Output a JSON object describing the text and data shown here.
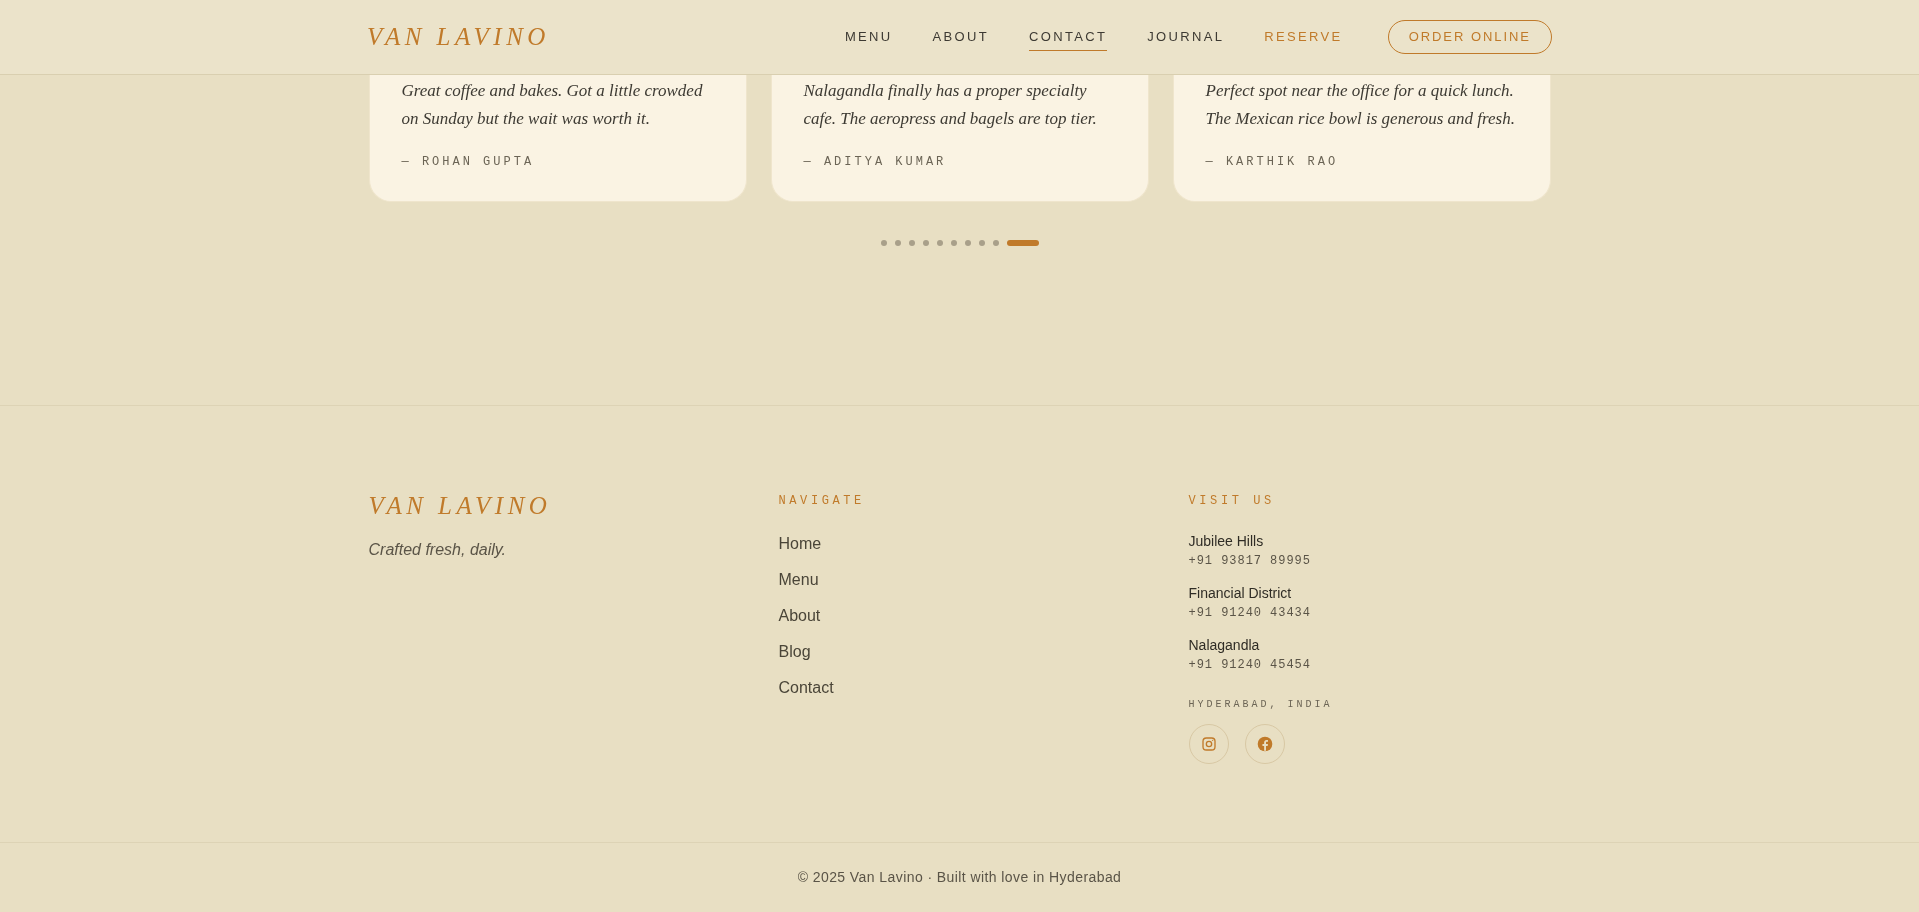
{
  "header": {
    "logo": "VAN LAVINO",
    "nav": [
      {
        "label": "MENU",
        "kind": "link",
        "selected": false
      },
      {
        "label": "ABOUT",
        "kind": "link",
        "selected": false
      },
      {
        "label": "CONTACT",
        "kind": "link",
        "selected": true
      },
      {
        "label": "JOURNAL",
        "kind": "link",
        "selected": false
      },
      {
        "label": "RESERVE",
        "kind": "accent",
        "selected": false
      }
    ],
    "cta": "ORDER ONLINE"
  },
  "testimonials": {
    "cards": [
      {
        "lines": [
          "Great coffee and bakes. Got a little crowded",
          "on Sunday but the wait was worth it."
        ],
        "author": "— ROHAN GUPTA"
      },
      {
        "lines": [
          "Nalagandla finally has a proper specialty",
          "cafe. The aeropress and bagels are top tier."
        ],
        "author": "— ADITYA KUMAR"
      },
      {
        "lines": [
          "Perfect spot near the office for a quick lunch.",
          "The Mexican rice bowl is generous and fresh."
        ],
        "author": "— KARTHIK RAO"
      }
    ],
    "dots": [
      {
        "selected": false
      },
      {
        "selected": false
      },
      {
        "selected": false
      },
      {
        "selected": false
      },
      {
        "selected": false
      },
      {
        "selected": false
      },
      {
        "selected": false
      },
      {
        "selected": false
      },
      {
        "selected": false
      },
      {
        "selected": true
      }
    ]
  },
  "footer": {
    "logo": "VAN LAVINO",
    "tagline": "Crafted fresh, daily.",
    "navigate": {
      "heading": "NAVIGATE",
      "links": [
        "Home",
        "Menu",
        "About",
        "Blog",
        "Contact"
      ]
    },
    "visit": {
      "heading": "VISIT US",
      "locations": [
        {
          "name": "Jubilee Hills",
          "phone": "+91 93817 89995"
        },
        {
          "name": "Financial District",
          "phone": "+91 91240 43434"
        },
        {
          "name": "Nalagandla",
          "phone": "+91 91240 45454"
        }
      ],
      "city": "HYDERABAD, INDIA",
      "social": [
        {
          "kind": "instagram"
        },
        {
          "kind": "facebook"
        }
      ]
    },
    "copyright": "© 2025 Van Lavino · Built with love in Hyderabad"
  }
}
